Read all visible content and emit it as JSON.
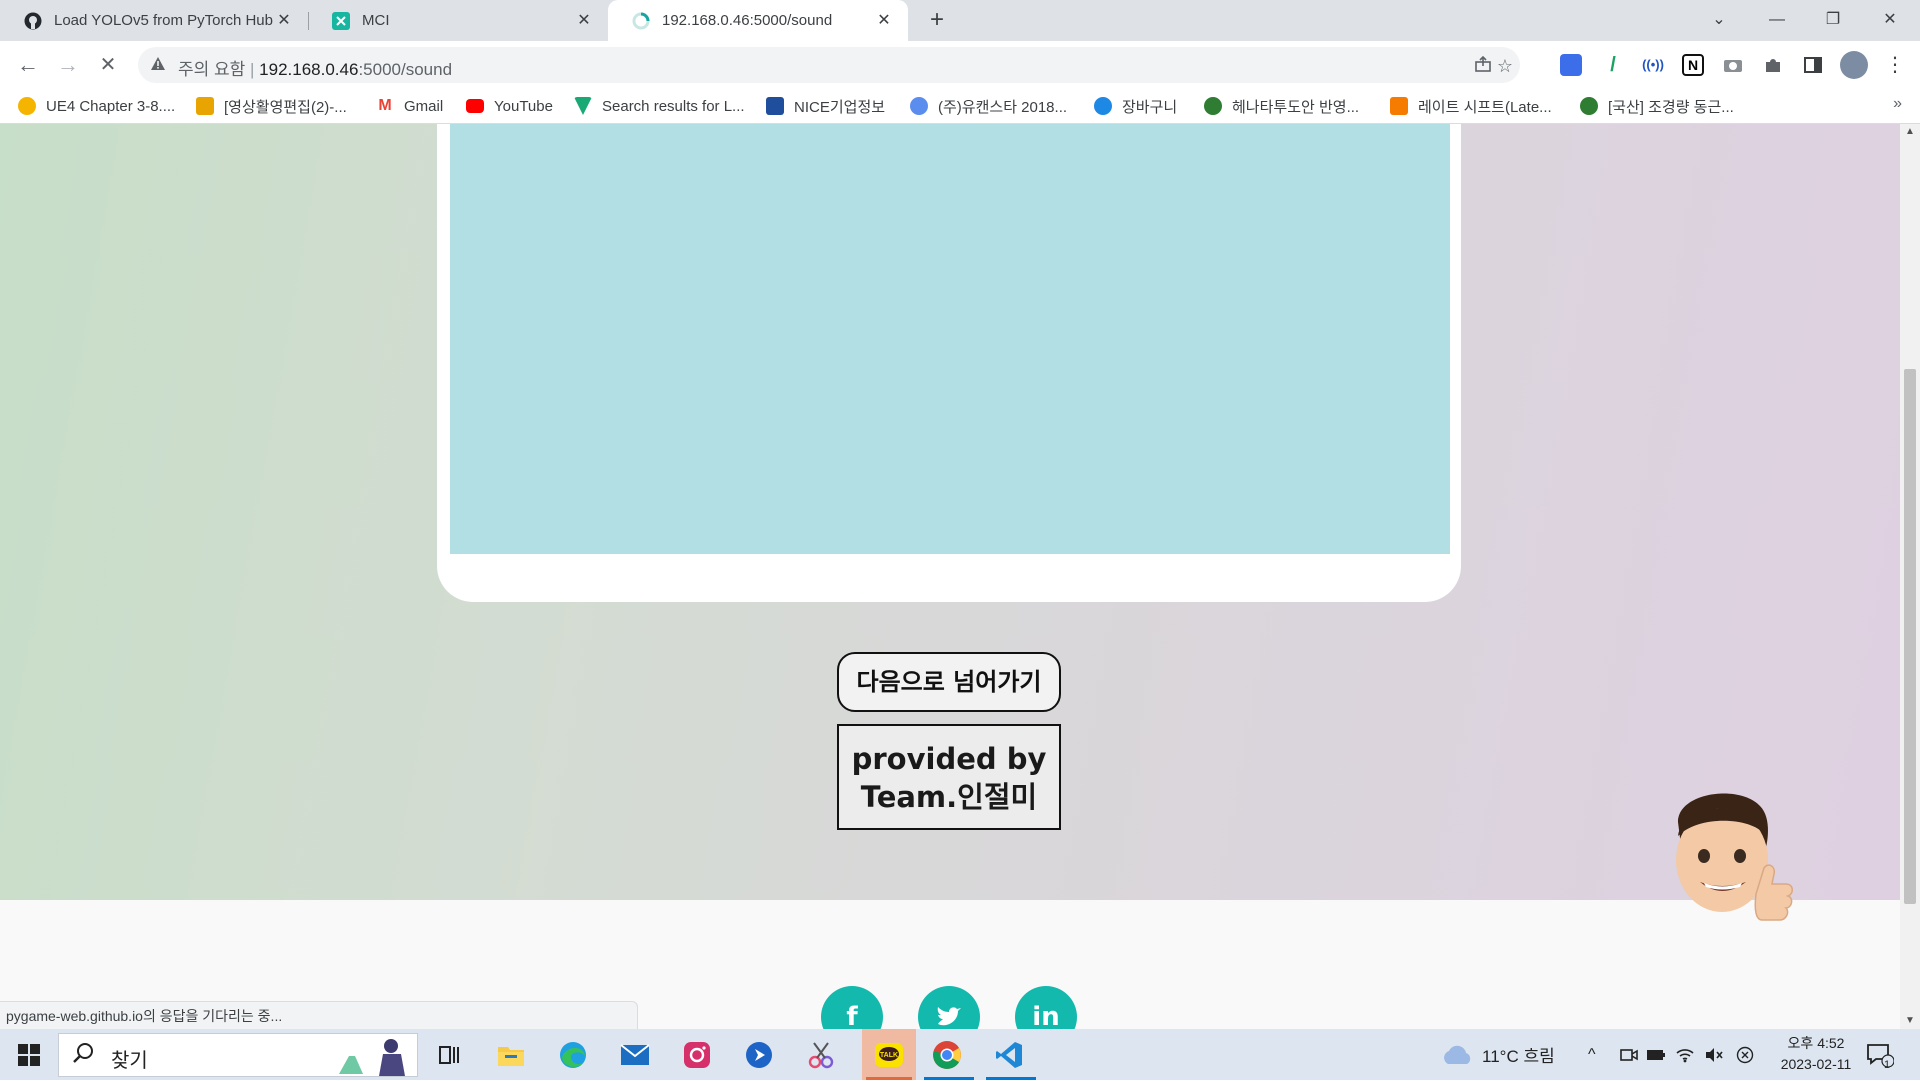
{
  "browser": {
    "tabs": [
      {
        "title": "Load YOLOv5 from PyTorch Hub",
        "icon": "github-icon",
        "active": false
      },
      {
        "title": "MCI",
        "icon": "mci-icon",
        "active": false
      },
      {
        "title": "192.168.0.46:5000/sound",
        "icon": "loading-icon",
        "active": true
      }
    ],
    "close_glyph": "✕",
    "new_tab_glyph": "+",
    "window_controls": {
      "list": "⌄",
      "minimize": "—",
      "restore": "❐",
      "close": "✕"
    },
    "toolbar": {
      "back": "←",
      "forward": "→",
      "stop": "✕",
      "security_warning": "주의 요함",
      "url_host": "192.168.0.46",
      "url_rest": ":5000/sound"
    },
    "bookmarks": [
      {
        "label": "UE4 Chapter 3-8....",
        "color": "#f4b400"
      },
      {
        "label": "[영상활영편집(2)-...",
        "color": "#e8a400"
      },
      {
        "label": "Gmail",
        "color": "#ea4335"
      },
      {
        "label": "YouTube",
        "color": "#ff0000"
      },
      {
        "label": "Search results for L...",
        "color": "#19a974"
      },
      {
        "label": "NICE기업정보",
        "color": "#1f4e9c"
      },
      {
        "label": "(주)유캔스타 2018...",
        "color": "#5b8def"
      },
      {
        "label": "장바구니",
        "color": "#1e88e5"
      },
      {
        "label": "헤나타투도안 반영...",
        "color": "#2e7d32"
      },
      {
        "label": "레이트 시프트(Late...",
        "color": "#f57c00"
      },
      {
        "label": "[국산] 조경량 동근...",
        "color": "#2e7d32"
      }
    ],
    "bookmarks_more": "»",
    "status_text": "pygame-web.github.io의 응답을 기다리는 중..."
  },
  "page": {
    "next_button_label": "다음으로 넘어가기",
    "credit_line1": "provided by",
    "credit_line2": "Team.인절미",
    "social": [
      "f",
      "t",
      "in"
    ]
  },
  "taskbar": {
    "search_label": "찾기",
    "weather": "11°C  흐림",
    "clock_time": "오후 4:52",
    "clock_date": "2023-02-11",
    "notification_count": "1"
  },
  "colors": {
    "card_inner": "#b2dfe4",
    "social_accent": "#14b9ad",
    "gradient_left": "#c7dec8",
    "gradient_right": "#dfd0e1"
  }
}
